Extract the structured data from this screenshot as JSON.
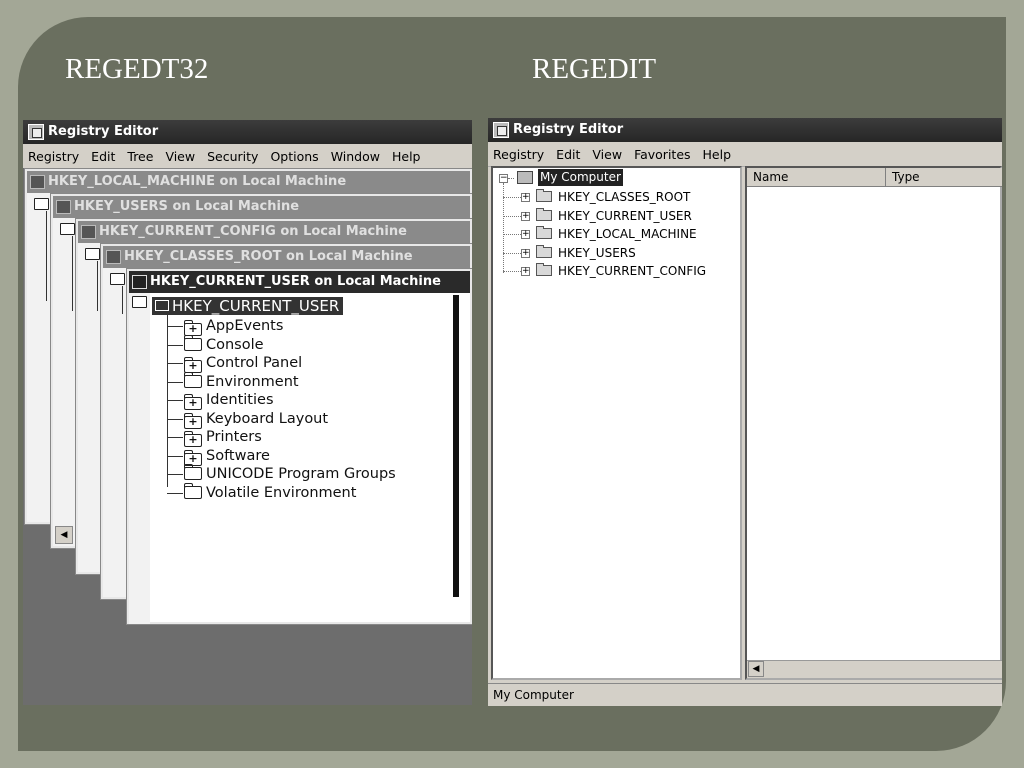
{
  "slide": {
    "left_title": "REGEDT32",
    "right_title": "REGEDIT"
  },
  "regedt32": {
    "window_title": "Registry Editor",
    "menu": [
      "Registry",
      "Edit",
      "Tree",
      "View",
      "Security",
      "Options",
      "Window",
      "Help"
    ],
    "child_windows": [
      "HKEY_LOCAL_MACHINE on Local Machine",
      "HKEY_USERS on Local Machine",
      "HKEY_CURRENT_CONFIG on Local Machine",
      "HKEY_CLASSES_ROOT on Local Machine",
      "HKEY_CURRENT_USER on Local Machine"
    ],
    "root_key": "HKEY_CURRENT_USER",
    "subkeys": [
      {
        "label": "AppEvents",
        "expandable": true
      },
      {
        "label": "Console",
        "expandable": false
      },
      {
        "label": "Control Panel",
        "expandable": true
      },
      {
        "label": "Environment",
        "expandable": false
      },
      {
        "label": "Identities",
        "expandable": true
      },
      {
        "label": "Keyboard Layout",
        "expandable": true
      },
      {
        "label": "Printers",
        "expandable": true
      },
      {
        "label": "Software",
        "expandable": true
      },
      {
        "label": "UNICODE Program Groups",
        "expandable": false
      },
      {
        "label": "Volatile Environment",
        "expandable": false
      }
    ]
  },
  "regedit": {
    "window_title": "Registry Editor",
    "menu": [
      "Registry",
      "Edit",
      "View",
      "Favorites",
      "Help"
    ],
    "root": "My Computer",
    "hives": [
      "HKEY_CLASSES_ROOT",
      "HKEY_CURRENT_USER",
      "HKEY_LOCAL_MACHINE",
      "HKEY_USERS",
      "HKEY_CURRENT_CONFIG"
    ],
    "columns": [
      "Name",
      "Type"
    ],
    "status": "My Computer"
  }
}
